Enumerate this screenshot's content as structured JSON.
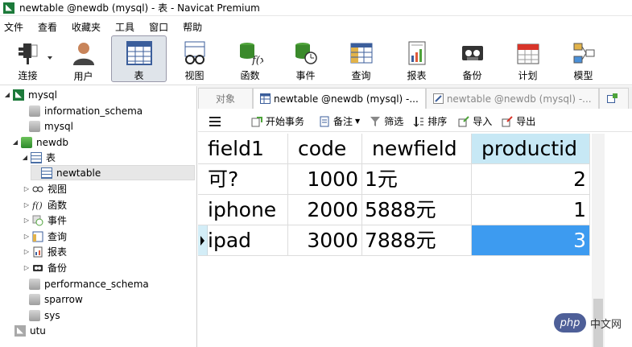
{
  "window": {
    "title": "newtable @newdb (mysql) - 表 - Navicat Premium"
  },
  "menu": [
    "文件",
    "查看",
    "收藏夹",
    "工具",
    "窗口",
    "帮助"
  ],
  "toolbar": [
    {
      "label": "连接",
      "icon": "plug-icon"
    },
    {
      "label": "用户",
      "icon": "user-icon"
    },
    {
      "label": "表",
      "icon": "table-icon",
      "active": true
    },
    {
      "label": "视图",
      "icon": "view-icon"
    },
    {
      "label": "函数",
      "icon": "function-icon"
    },
    {
      "label": "事件",
      "icon": "event-icon"
    },
    {
      "label": "查询",
      "icon": "query-icon"
    },
    {
      "label": "报表",
      "icon": "report-icon"
    },
    {
      "label": "备份",
      "icon": "backup-icon"
    },
    {
      "label": "计划",
      "icon": "schedule-icon"
    },
    {
      "label": "模型",
      "icon": "model-icon"
    }
  ],
  "tree": {
    "mysql": "mysql",
    "information_schema": "information_schema",
    "mysql_db": "mysql",
    "newdb": "newdb",
    "tables_folder": "表",
    "newtable": "newtable",
    "views": "视图",
    "functions": "函数",
    "events": "事件",
    "queries": "查询",
    "reports": "报表",
    "backups": "备份",
    "performance_schema": "performance_schema",
    "sparrow": "sparrow",
    "sys": "sys",
    "utu": "utu"
  },
  "tabs": {
    "objects": "对象",
    "current": "newtable @newdb (mysql) -...",
    "design": "newtable @newdb (mysql) -..."
  },
  "grid_toolbar": {
    "begin_transaction": "开始事务",
    "memo": "备注",
    "filter": "筛选",
    "sort": "排序",
    "import": "导入",
    "export": "导出"
  },
  "table": {
    "columns": [
      "field1",
      "code",
      "newfield",
      "productid"
    ],
    "rows": [
      [
        "可?",
        "1000",
        "1元",
        "2"
      ],
      [
        "iphone",
        "2000",
        "5888元",
        "1"
      ],
      [
        "ipad",
        "3000",
        "7888元",
        "3"
      ]
    ]
  },
  "watermark": {
    "logo": "php",
    "text": "中文网"
  },
  "colors": {
    "selected_cell": "#3d9bf0",
    "header_highlight": "#c7e8f5",
    "row_marker": "#d3edf7"
  }
}
